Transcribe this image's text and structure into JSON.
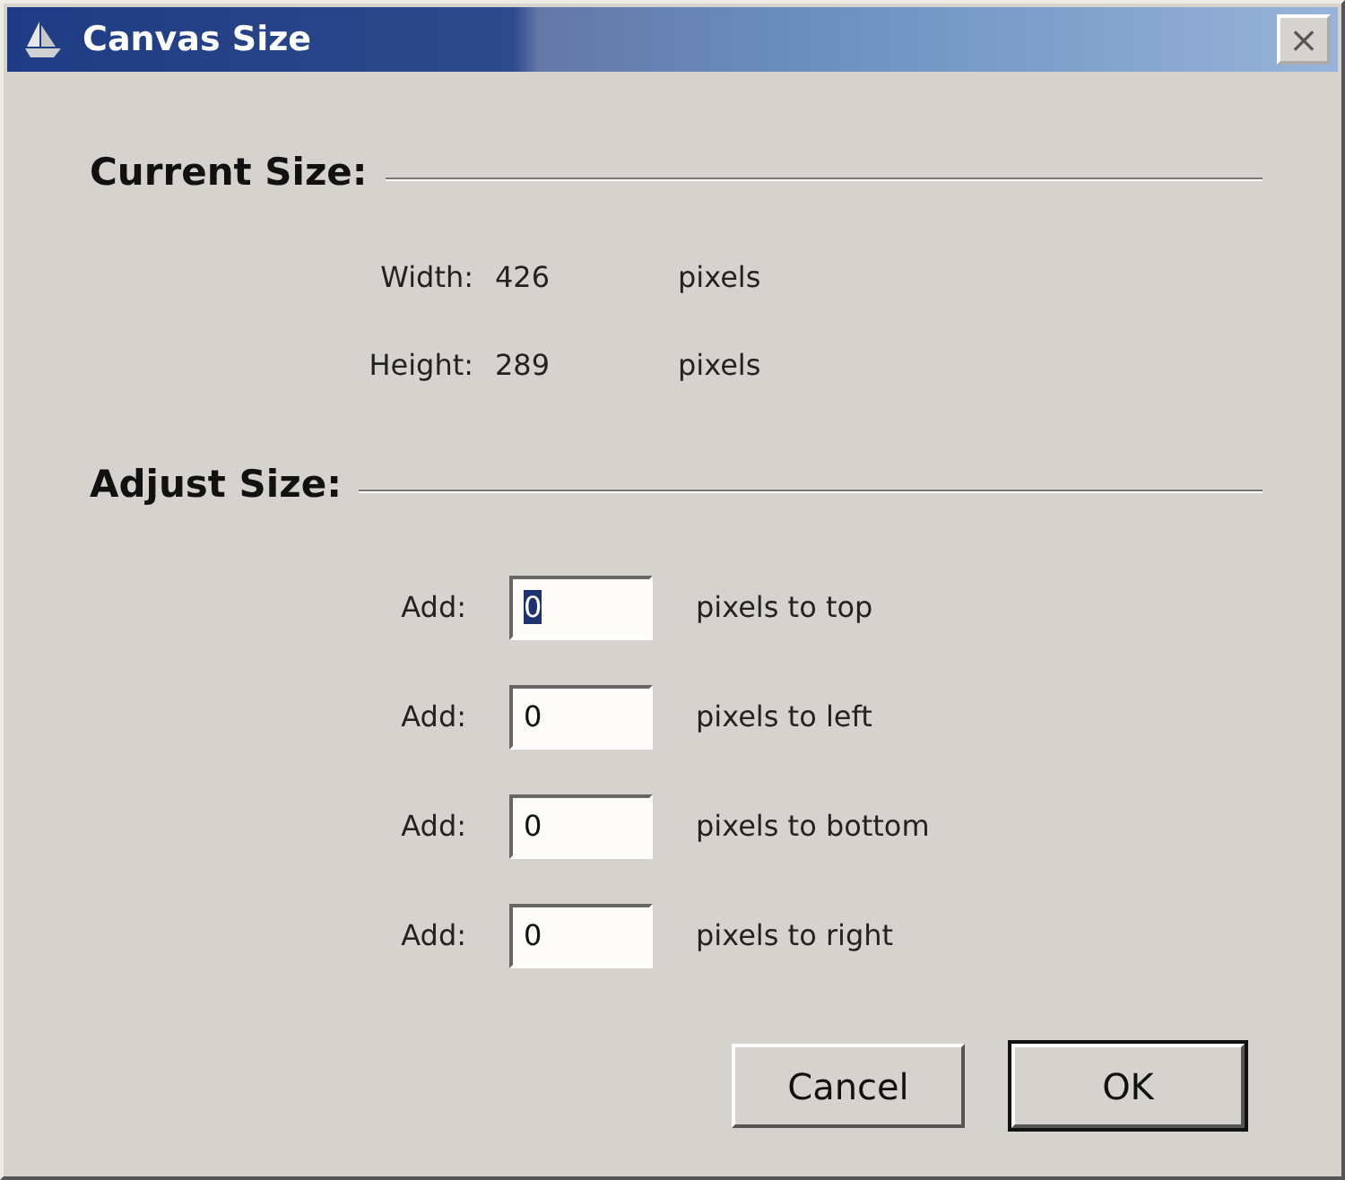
{
  "window": {
    "title": "Canvas Size",
    "close": "×"
  },
  "current_size": {
    "heading": "Current Size:",
    "rows": [
      {
        "label": "Width:",
        "value": "426",
        "unit": "pixels"
      },
      {
        "label": "Height:",
        "value": "289",
        "unit": "pixels"
      }
    ]
  },
  "adjust_size": {
    "heading": "Adjust Size:",
    "rows": [
      {
        "label": "Add:",
        "value": "0",
        "unit": "pixels to top",
        "focused": true
      },
      {
        "label": "Add:",
        "value": "0",
        "unit": "pixels to left",
        "focused": false
      },
      {
        "label": "Add:",
        "value": "0",
        "unit": "pixels to bottom",
        "focused": false
      },
      {
        "label": "Add:",
        "value": "0",
        "unit": "pixels to right",
        "focused": false
      }
    ]
  },
  "buttons": [
    {
      "label": "Cancel",
      "default": false
    },
    {
      "label": "OK",
      "default": true
    }
  ]
}
